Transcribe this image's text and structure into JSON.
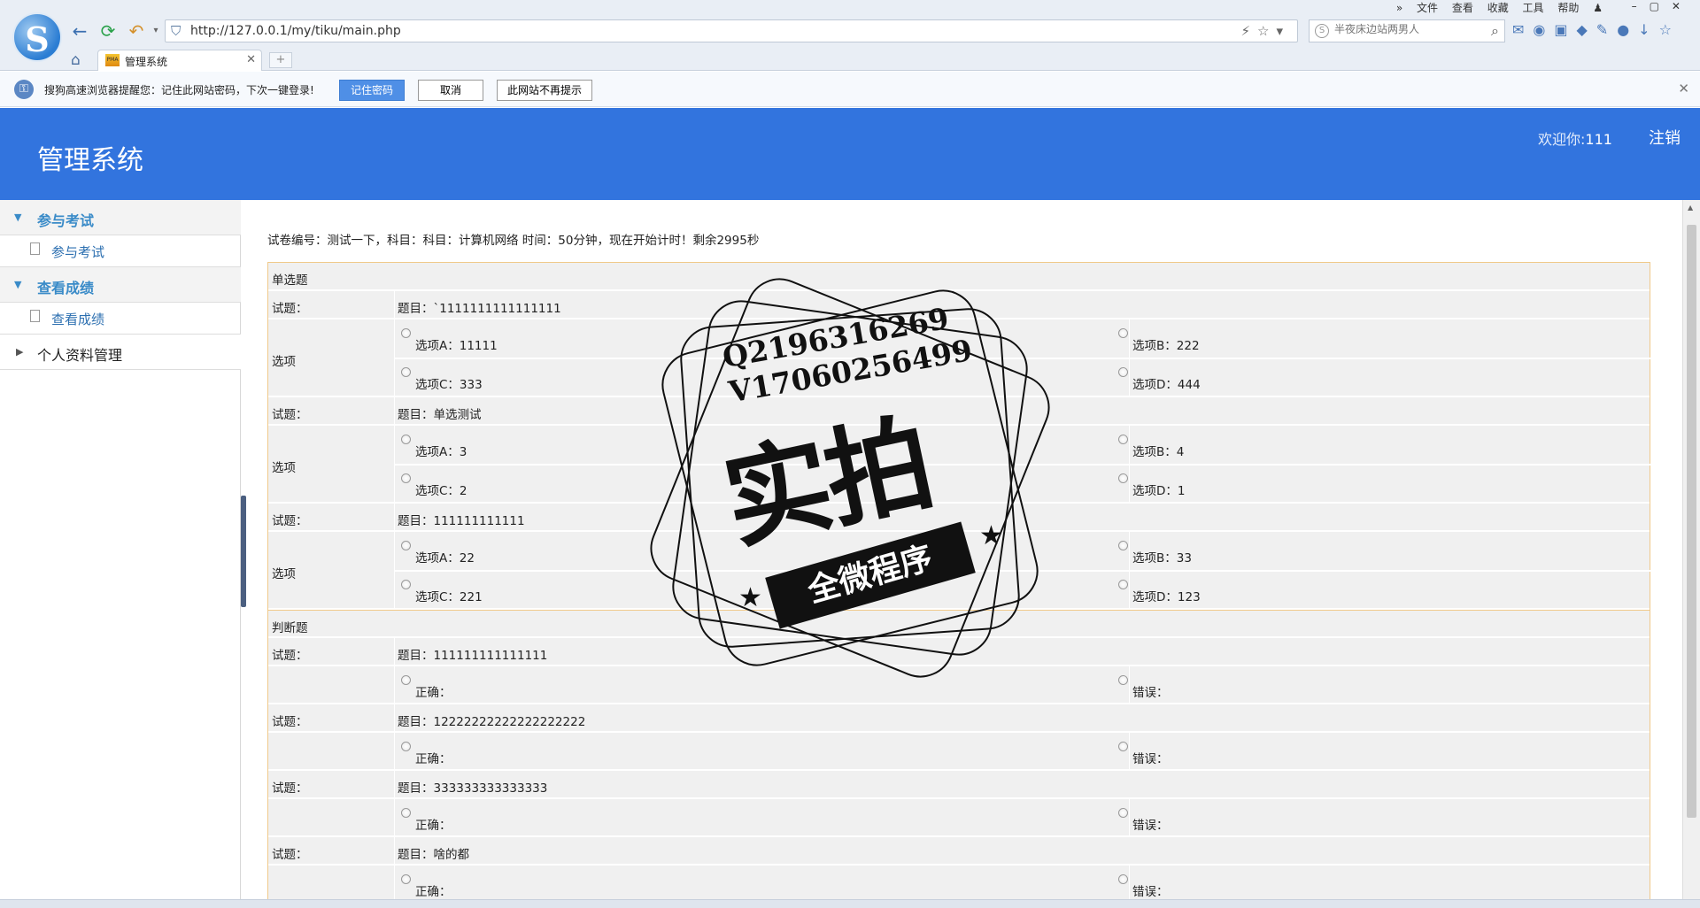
{
  "browser": {
    "url": "http://127.0.0.1/my/tiku/main.php",
    "search_placeholder": "半夜床边站两男人",
    "tab_title": "管理系统",
    "tab_favicon_text": "PMA",
    "menu": [
      "文件",
      "查看",
      "收藏",
      "工具",
      "帮助"
    ],
    "password_prompt": {
      "message": "搜狗高速浏览器提醒您：记住此网站密码，下次一键登录!",
      "remember": "记住密码",
      "cancel": "取消",
      "never": "此网站不再提示"
    }
  },
  "header": {
    "title": "管理系统",
    "welcome_prefix": "欢迎你:",
    "username": "111",
    "logout": "注销"
  },
  "sidebar": {
    "groups": [
      {
        "label": "参与考试",
        "item": "参与考试"
      },
      {
        "label": "查看成绩",
        "item": "查看成绩"
      }
    ],
    "profile": "个人资料管理"
  },
  "exam": {
    "info": "试卷编号：测试一下，科目：科目：计算机网络 时间：50分钟，现在开始计时！剩余2995秒",
    "single_section": "单选题",
    "judge_section": "判断题",
    "question_label": "试题：",
    "option_label": "选项",
    "single": [
      {
        "q": "题目：`1111111111111111",
        "a": "选项A：11111",
        "b": "选项B：222",
        "c": "选项C：333",
        "d": "选项D：444"
      },
      {
        "q": "题目：单选测试",
        "a": "选项A：3",
        "b": "选项B：4",
        "c": "选项C：2",
        "d": "选项D：1"
      },
      {
        "q": "题目：111111111111",
        "a": "选项A：22",
        "b": "选项B：33",
        "c": "选项C：221",
        "d": "选项D：123"
      }
    ],
    "judge_true": "正确：",
    "judge_false": "错误：",
    "judge": [
      {
        "q": "题目：111111111111111"
      },
      {
        "q": "题目：12222222222222222222"
      },
      {
        "q": "题目：333333333333333"
      },
      {
        "q": "题目：啥的都"
      }
    ]
  },
  "watermark": {
    "line1": "Q2196316269",
    "line2": "V17060256499",
    "main": "实拍",
    "banner": "全微程序"
  }
}
